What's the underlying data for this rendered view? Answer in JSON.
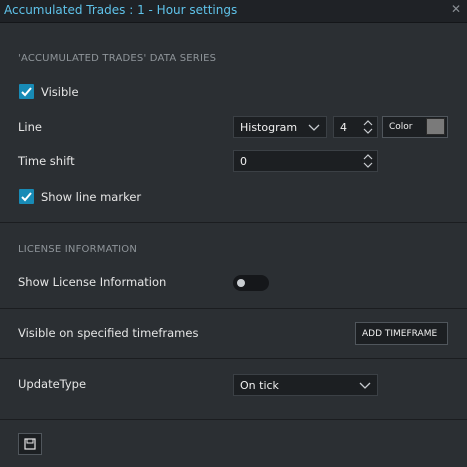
{
  "window": {
    "title": "Accumulated Trades : 1 - Hour settings",
    "close_icon": "close-icon"
  },
  "data_series": {
    "section_label": "'ACCUMULATED TRADES' DATA SERIES",
    "visible_label": "Visible",
    "visible_checked": true,
    "line_label": "Line",
    "line_type_value": "Histogram",
    "line_width_value": "4",
    "color_label": "Color",
    "color_value": "#7a7a7a",
    "time_shift_label": "Time shift",
    "time_shift_value": "0",
    "show_line_marker_label": "Show line marker",
    "show_line_marker_checked": true
  },
  "license": {
    "section_label": "LICENSE INFORMATION",
    "show_license_label": "Show License Information",
    "show_license_on": false
  },
  "timeframes": {
    "label": "Visible on specified timeframes",
    "add_button_label": "ADD TIMEFRAME"
  },
  "update": {
    "label": "UpdateType",
    "value": "On tick"
  },
  "footer": {
    "save_icon": "save-icon"
  },
  "colors": {
    "accent": "#188bb6",
    "title": "#5fc3ea",
    "background": "#2b2f33"
  }
}
